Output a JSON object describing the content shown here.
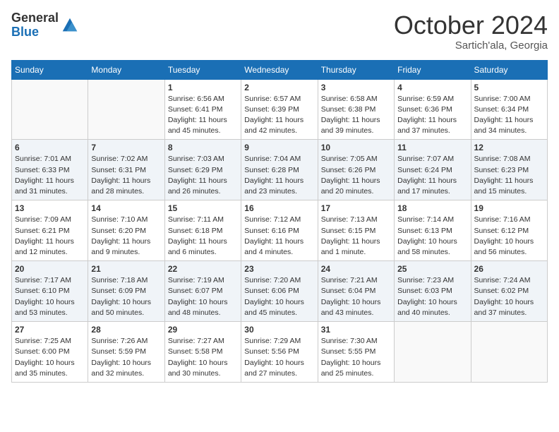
{
  "header": {
    "logo_line1": "General",
    "logo_line2": "Blue",
    "month": "October 2024",
    "location": "Sartich'ala, Georgia"
  },
  "weekdays": [
    "Sunday",
    "Monday",
    "Tuesday",
    "Wednesday",
    "Thursday",
    "Friday",
    "Saturday"
  ],
  "weeks": [
    [
      {
        "day": "",
        "info": ""
      },
      {
        "day": "",
        "info": ""
      },
      {
        "day": "1",
        "info": "Sunrise: 6:56 AM\nSunset: 6:41 PM\nDaylight: 11 hours and 45 minutes."
      },
      {
        "day": "2",
        "info": "Sunrise: 6:57 AM\nSunset: 6:39 PM\nDaylight: 11 hours and 42 minutes."
      },
      {
        "day": "3",
        "info": "Sunrise: 6:58 AM\nSunset: 6:38 PM\nDaylight: 11 hours and 39 minutes."
      },
      {
        "day": "4",
        "info": "Sunrise: 6:59 AM\nSunset: 6:36 PM\nDaylight: 11 hours and 37 minutes."
      },
      {
        "day": "5",
        "info": "Sunrise: 7:00 AM\nSunset: 6:34 PM\nDaylight: 11 hours and 34 minutes."
      }
    ],
    [
      {
        "day": "6",
        "info": "Sunrise: 7:01 AM\nSunset: 6:33 PM\nDaylight: 11 hours and 31 minutes."
      },
      {
        "day": "7",
        "info": "Sunrise: 7:02 AM\nSunset: 6:31 PM\nDaylight: 11 hours and 28 minutes."
      },
      {
        "day": "8",
        "info": "Sunrise: 7:03 AM\nSunset: 6:29 PM\nDaylight: 11 hours and 26 minutes."
      },
      {
        "day": "9",
        "info": "Sunrise: 7:04 AM\nSunset: 6:28 PM\nDaylight: 11 hours and 23 minutes."
      },
      {
        "day": "10",
        "info": "Sunrise: 7:05 AM\nSunset: 6:26 PM\nDaylight: 11 hours and 20 minutes."
      },
      {
        "day": "11",
        "info": "Sunrise: 7:07 AM\nSunset: 6:24 PM\nDaylight: 11 hours and 17 minutes."
      },
      {
        "day": "12",
        "info": "Sunrise: 7:08 AM\nSunset: 6:23 PM\nDaylight: 11 hours and 15 minutes."
      }
    ],
    [
      {
        "day": "13",
        "info": "Sunrise: 7:09 AM\nSunset: 6:21 PM\nDaylight: 11 hours and 12 minutes."
      },
      {
        "day": "14",
        "info": "Sunrise: 7:10 AM\nSunset: 6:20 PM\nDaylight: 11 hours and 9 minutes."
      },
      {
        "day": "15",
        "info": "Sunrise: 7:11 AM\nSunset: 6:18 PM\nDaylight: 11 hours and 6 minutes."
      },
      {
        "day": "16",
        "info": "Sunrise: 7:12 AM\nSunset: 6:16 PM\nDaylight: 11 hours and 4 minutes."
      },
      {
        "day": "17",
        "info": "Sunrise: 7:13 AM\nSunset: 6:15 PM\nDaylight: 11 hours and 1 minute."
      },
      {
        "day": "18",
        "info": "Sunrise: 7:14 AM\nSunset: 6:13 PM\nDaylight: 10 hours and 58 minutes."
      },
      {
        "day": "19",
        "info": "Sunrise: 7:16 AM\nSunset: 6:12 PM\nDaylight: 10 hours and 56 minutes."
      }
    ],
    [
      {
        "day": "20",
        "info": "Sunrise: 7:17 AM\nSunset: 6:10 PM\nDaylight: 10 hours and 53 minutes."
      },
      {
        "day": "21",
        "info": "Sunrise: 7:18 AM\nSunset: 6:09 PM\nDaylight: 10 hours and 50 minutes."
      },
      {
        "day": "22",
        "info": "Sunrise: 7:19 AM\nSunset: 6:07 PM\nDaylight: 10 hours and 48 minutes."
      },
      {
        "day": "23",
        "info": "Sunrise: 7:20 AM\nSunset: 6:06 PM\nDaylight: 10 hours and 45 minutes."
      },
      {
        "day": "24",
        "info": "Sunrise: 7:21 AM\nSunset: 6:04 PM\nDaylight: 10 hours and 43 minutes."
      },
      {
        "day": "25",
        "info": "Sunrise: 7:23 AM\nSunset: 6:03 PM\nDaylight: 10 hours and 40 minutes."
      },
      {
        "day": "26",
        "info": "Sunrise: 7:24 AM\nSunset: 6:02 PM\nDaylight: 10 hours and 37 minutes."
      }
    ],
    [
      {
        "day": "27",
        "info": "Sunrise: 7:25 AM\nSunset: 6:00 PM\nDaylight: 10 hours and 35 minutes."
      },
      {
        "day": "28",
        "info": "Sunrise: 7:26 AM\nSunset: 5:59 PM\nDaylight: 10 hours and 32 minutes."
      },
      {
        "day": "29",
        "info": "Sunrise: 7:27 AM\nSunset: 5:58 PM\nDaylight: 10 hours and 30 minutes."
      },
      {
        "day": "30",
        "info": "Sunrise: 7:29 AM\nSunset: 5:56 PM\nDaylight: 10 hours and 27 minutes."
      },
      {
        "day": "31",
        "info": "Sunrise: 7:30 AM\nSunset: 5:55 PM\nDaylight: 10 hours and 25 minutes."
      },
      {
        "day": "",
        "info": ""
      },
      {
        "day": "",
        "info": ""
      }
    ]
  ]
}
